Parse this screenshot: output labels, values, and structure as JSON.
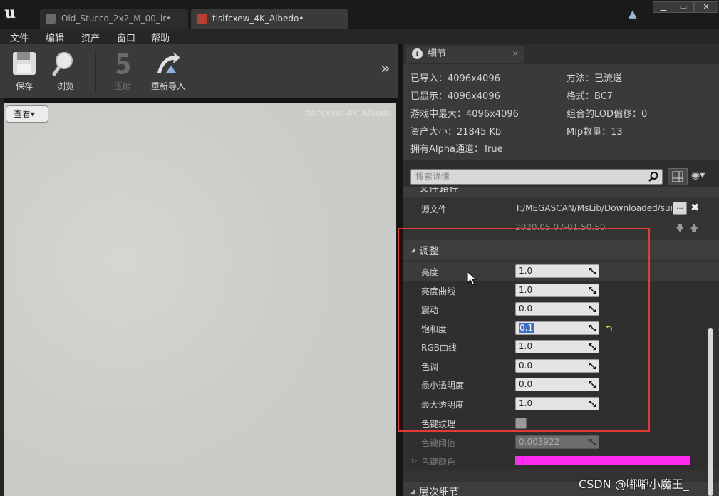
{
  "title_bar": {
    "tabs": [
      {
        "label": "Old_Stucco_2x2_M_00_ir•",
        "active": false
      },
      {
        "label": "tlslfcxew_4K_Albedo•",
        "active": true
      }
    ]
  },
  "menu": [
    "文件",
    "编辑",
    "资产",
    "窗口",
    "帮助"
  ],
  "toolbar": {
    "save": "保存",
    "browse": "浏览",
    "compress": "压缩",
    "reimport": "重新导入"
  },
  "viewport": {
    "view_menu": "查看▾",
    "asset_name": "tlslfcxew_4K_Albedo"
  },
  "details": {
    "tab_label": "细节",
    "info": {
      "imported": "已导入：4096x4096",
      "displayed": "已显示：4096x4096",
      "max_ingame": "游戏中最大：4096x4096",
      "asset_size": "资产大小：21845 Kb",
      "has_alpha": "拥有Alpha通道：True",
      "method": "方法：已流送",
      "format": "格式：BC7",
      "lod_bias": "组合的LOD偏移：0",
      "mip_count": "Mip数量：13"
    },
    "search_placeholder": "搜索详情",
    "file_path": {
      "category": "文件路径",
      "source_label": "源文件",
      "source_value": "T:/MEGASCAN/MsLib/Downloaded/surfa",
      "timestamp": "2020.05.07-01.50.50",
      "browse_label": "..."
    },
    "adjust": {
      "category": "调整",
      "rows": [
        {
          "label": "亮度",
          "value": "1.0"
        },
        {
          "label": "亮度曲线",
          "value": "1.0"
        },
        {
          "label": "震动",
          "value": "0.0"
        },
        {
          "label": "饱和度",
          "value": "0.1"
        },
        {
          "label": "RGB曲线",
          "value": "1.0"
        },
        {
          "label": "色调",
          "value": "0.0"
        },
        {
          "label": "最小透明度",
          "value": "0.0"
        },
        {
          "label": "最大透明度",
          "value": "1.0"
        }
      ],
      "chroma_key_texture": "色键纹理",
      "chroma_key_threshold_label": "色键阈值",
      "chroma_key_threshold_value": "0.003922",
      "chroma_key_color_label": "色键颜色",
      "chroma_key_color": "#ff2bf0"
    },
    "lod_category": "层次细节"
  },
  "watermark": "CSDN @嘟嘟小魔王_"
}
